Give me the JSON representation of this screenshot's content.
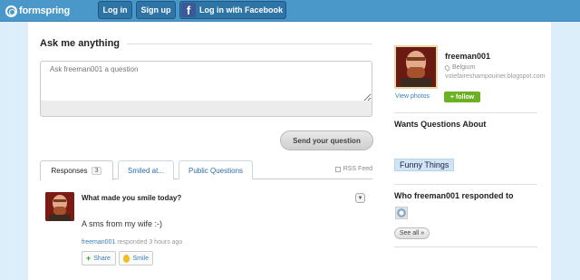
{
  "header": {
    "logo_text": "formspring",
    "login_label": "Log in",
    "signup_label": "Sign up",
    "facebook_label": "Log in with Facebook",
    "facebook_glyph": "f"
  },
  "ask": {
    "title": "Ask me anything",
    "placeholder": "Ask freeman001 a question",
    "send_label": "Send your question"
  },
  "tabs": [
    {
      "label": "Responses",
      "count": "3"
    },
    {
      "label": "Smiled at..."
    },
    {
      "label": "Public Questions"
    }
  ],
  "rss_label": "RSS Feed",
  "response": {
    "question": "What made you smile today?",
    "answer": "A sms from my wife :-)",
    "user": "freeman001",
    "meta": "responded 3 hours ago",
    "share_label": "Share",
    "smile_label": "Smile"
  },
  "profile": {
    "username": "freeman001",
    "location": "Belgium",
    "website": "votefaireshampouiner.blogspot.com",
    "view_photos_label": "View photos",
    "follow_label": "+ follow"
  },
  "sidebar": {
    "wants_title": "Wants Questions About",
    "tag": "Funny Things",
    "responded_title": "Who freeman001 responded to",
    "see_all_label": "See all »"
  },
  "colors": {
    "topbar": "#4a97c9",
    "page_bg": "#dbeefa",
    "link": "#3a7fb4",
    "follow": "#6bb121"
  }
}
